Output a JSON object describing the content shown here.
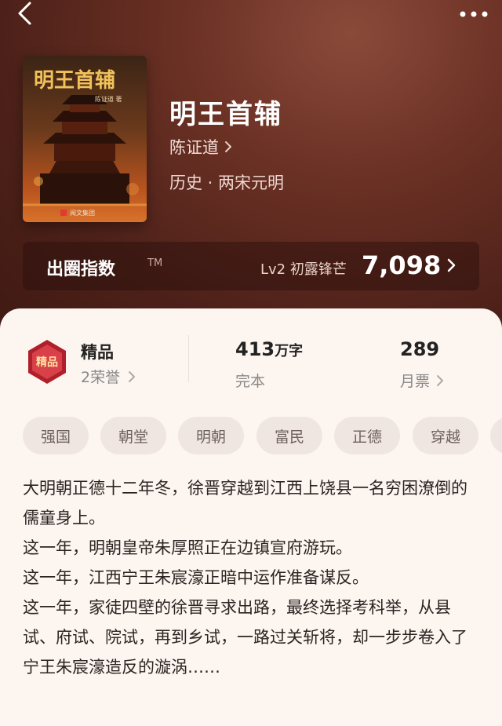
{
  "book": {
    "title": "明王首辅",
    "author": "陈证道",
    "genre": "历史 · 两宋元明",
    "cover": {
      "title_text": "明王首辅",
      "author_text": "陈证道 著",
      "publisher_text": "阅文集团"
    }
  },
  "index_bar": {
    "label": "出圈指数",
    "tm": "TM",
    "level": "Lv2 初露锋芒",
    "value": "7,098"
  },
  "stats": {
    "quality": {
      "title": "精品",
      "honors": "2荣誉",
      "badge_text": "精品"
    },
    "words": {
      "number": "413",
      "unit": "万字",
      "status": "完本"
    },
    "monthly_ticket": {
      "number": "289",
      "label": "月票"
    }
  },
  "tags": [
    "强国",
    "朝堂",
    "明朝",
    "富民",
    "正德",
    "穿越",
    ""
  ],
  "synopsis": [
    "大明朝正德十二年冬，徐晋穿越到江西上饶县一名穷困潦倒的儒童身上。",
    "这一年，明朝皇帝朱厚照正在边镇宣府游玩。",
    "这一年，江西宁王朱宸濠正暗中运作准备谋反。",
    "这一年，家徒四壁的徐晋寻求出路，最终选择考科举，从县试、府试、院试，再到乡试，一路过关斩将，却一步步卷入了宁王朱宸濠造反的漩涡……"
  ],
  "colors": {
    "hero_bg": "#5a271d",
    "sheet_bg": "#fdf5f0",
    "tag_bg": "#f0e6e1",
    "badge_red": "#b0202a"
  }
}
